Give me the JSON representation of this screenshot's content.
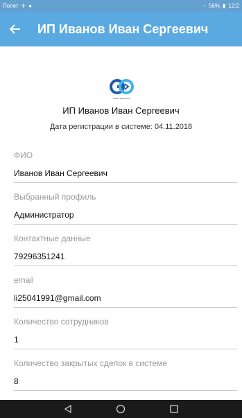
{
  "status_bar": {
    "left_text": "Полет",
    "right_text": "56%",
    "time": "12:2"
  },
  "app_bar": {
    "back_icon": "arrow-left-icon",
    "title": "ИП Иванов Иван Сергеевич"
  },
  "profile": {
    "logo_icon": "go-logo-icon",
    "logo_caption": "GREATPROCESS",
    "name": "ИП Иванов Иван Сергеевич",
    "registration_date": "Дата регистрации в системе: 04.11.2018"
  },
  "fields": [
    {
      "label": "ФИО",
      "value": "Иванов Иван Сергеевич"
    },
    {
      "label": "Выбранный профиль",
      "value": "Администратор"
    },
    {
      "label": "Контактные данные",
      "value": "79296351241"
    },
    {
      "label": "email",
      "value": "li25041991@gmail.com"
    },
    {
      "label": "Количество сотрудников",
      "value": "1"
    },
    {
      "label": "Количество закрытых сделок в системе",
      "value": "8"
    }
  ],
  "nav": {
    "back": "triangle-back-icon",
    "home": "circle-home-icon",
    "recents": "square-recents-icon"
  },
  "colors": {
    "app_bar": "#5aa9e0",
    "status_bar": "#4a90c8",
    "nav_bar": "#1a1a1a",
    "logo_blue": "#1c5aa8",
    "logo_light": "#3fb6e8"
  }
}
